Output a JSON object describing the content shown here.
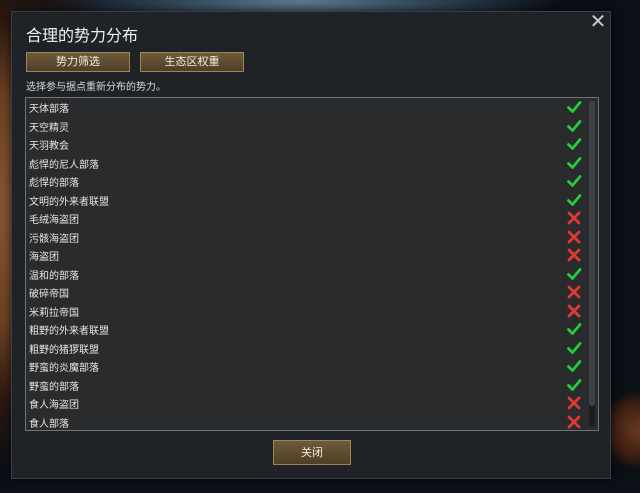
{
  "dialog": {
    "title": "合理的势力分布",
    "faction_filter_label": "势力筛选",
    "biome_weight_label": "生态区权重",
    "hint": "选择参与据点重新分布的势力。",
    "close_label": "关闭"
  },
  "factions": [
    {
      "name": "天体部落",
      "enabled": true
    },
    {
      "name": "天空精灵",
      "enabled": true
    },
    {
      "name": "天羽教会",
      "enabled": true
    },
    {
      "name": "彪悍的尼人部落",
      "enabled": true
    },
    {
      "name": "彪悍的部落",
      "enabled": true
    },
    {
      "name": "文明的外来者联盟",
      "enabled": true
    },
    {
      "name": "毛绒海盗团",
      "enabled": false
    },
    {
      "name": "污骸海盗团",
      "enabled": false
    },
    {
      "name": "海盗团",
      "enabled": false
    },
    {
      "name": "温和的部落",
      "enabled": true
    },
    {
      "name": "破碎帝国",
      "enabled": false
    },
    {
      "name": "米莉拉帝国",
      "enabled": false
    },
    {
      "name": "粗野的外来者联盟",
      "enabled": true
    },
    {
      "name": "粗野的猪猡联盟",
      "enabled": true
    },
    {
      "name": "野蛮的炎魔部落",
      "enabled": true
    },
    {
      "name": "野蛮的部落",
      "enabled": true
    },
    {
      "name": "食人海盗团",
      "enabled": false
    },
    {
      "name": "食人部落",
      "enabled": false
    }
  ],
  "colors": {
    "check": "#27c93f",
    "cross": "#e0393a"
  }
}
